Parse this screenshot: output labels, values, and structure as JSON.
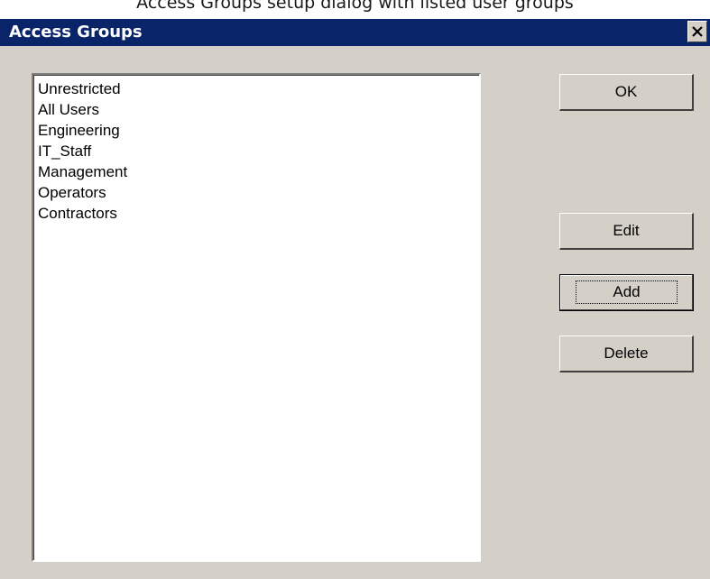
{
  "caption": "Access Groups setup dialog with listed user groups",
  "window": {
    "title": "Access Groups",
    "close_icon": "close-x-icon"
  },
  "groups_list": {
    "items": [
      "Unrestricted",
      "All Users",
      "Engineering",
      "IT_Staff",
      "Management",
      "Operators",
      "Contractors"
    ]
  },
  "buttons": {
    "ok": "OK",
    "edit": "Edit",
    "add": "Add",
    "delete": "Delete",
    "focused": "add"
  },
  "colors": {
    "titlebar": "#0a246a",
    "dialog_bg": "#d4d0c8",
    "list_bg": "#ffffff"
  }
}
